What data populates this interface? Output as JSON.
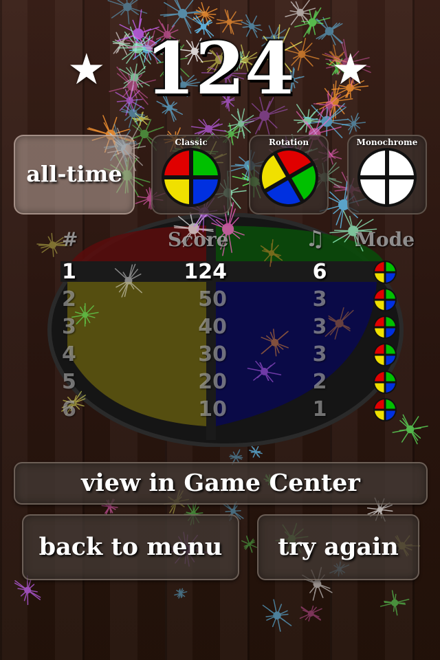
{
  "score": {
    "value": "124",
    "star_left": "★",
    "star_right": "★"
  },
  "filters": {
    "all_time": "all-time",
    "modes": [
      {
        "label": "Classic",
        "icon": "classic-mode-icon"
      },
      {
        "label": "Rotation",
        "icon": "rotation-mode-icon"
      },
      {
        "label": "Monochrome",
        "icon": "monochrome-mode-icon"
      }
    ]
  },
  "table": {
    "headers": {
      "rank": "#",
      "score": "Score",
      "notes": "♫",
      "mode": "Mode"
    },
    "rows": [
      {
        "rank": "1",
        "score": "124",
        "notes": "6",
        "mode": "classic"
      },
      {
        "rank": "2",
        "score": "50",
        "notes": "3",
        "mode": "classic"
      },
      {
        "rank": "3",
        "score": "40",
        "notes": "3",
        "mode": "classic"
      },
      {
        "rank": "4",
        "score": "30",
        "notes": "3",
        "mode": "classic"
      },
      {
        "rank": "5",
        "score": "20",
        "notes": "2",
        "mode": "classic"
      },
      {
        "rank": "6",
        "score": "10",
        "notes": "1",
        "mode": "classic"
      }
    ]
  },
  "buttons": {
    "game_center": "view in Game Center",
    "back_to_menu": "back to menu",
    "try_again": "try again"
  },
  "colors": {
    "red": "#e00000",
    "green": "#00c000",
    "yellow": "#f0e000",
    "blue": "#0030e0"
  }
}
